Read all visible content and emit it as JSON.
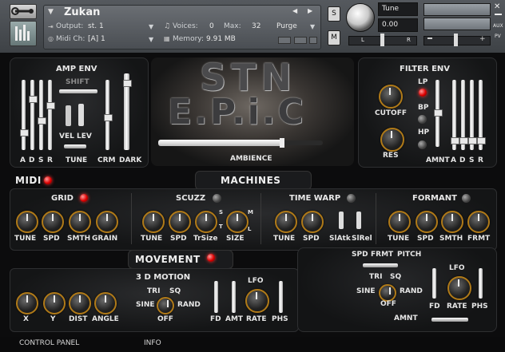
{
  "header": {
    "instrument_name": "Zukan",
    "output_label": "Output:",
    "output_value": "st. 1",
    "voices_label": "Voices:",
    "voices_value": "0",
    "max_label": "Max:",
    "max_value": "32",
    "purge_label": "Purge",
    "midi_label": "Midi Ch:",
    "midi_value": "[A] 1",
    "memory_label": "Memory:",
    "memory_value": "9.91 MB",
    "s_button": "S",
    "m_button": "M",
    "tune_label": "Tune",
    "tune_value": "0.00",
    "pan_left": "L",
    "pan_right": "R",
    "aux_label": "AUX",
    "pv_label": "PV",
    "nav_prev": "◀",
    "nav_next": "▶"
  },
  "logo": {
    "line1": "STN",
    "line2": "E.P.i.C",
    "ambience_label": "AMBIENCE"
  },
  "amp_env": {
    "title": "AMP ENV",
    "shift_label": "SHIFT",
    "vel_lev_label": "VEL LEV",
    "slider_labels": [
      "A",
      "D",
      "S",
      "R"
    ],
    "tune_label": "TUNE",
    "crm_label": "CRM",
    "dark_label": "DARK"
  },
  "filter_env": {
    "title": "FILTER ENV",
    "cutoff_label": "CUTOFF",
    "res_label": "RES",
    "lp_label": "LP",
    "bp_label": "BP",
    "hp_label": "HP",
    "amnt_label": "AMNT",
    "slider_labels": [
      "A",
      "D",
      "S",
      "R"
    ]
  },
  "midi_label": "MIDI",
  "machines_label": "MACHINES",
  "grid": {
    "title": "GRID",
    "knob_labels": [
      "TUNE",
      "SPD",
      "SMTH",
      "GRAIN"
    ]
  },
  "scuzz": {
    "title": "SCUZZ",
    "knob_labels": [
      "TUNE",
      "SPD",
      "TrSize",
      "SIZE"
    ],
    "size_marks": [
      "S",
      "T",
      "M",
      "L"
    ]
  },
  "time_warp": {
    "title": "TIME WARP",
    "knob_labels": [
      "TUNE",
      "SPD",
      "SlAtk",
      "SlRel"
    ]
  },
  "formant": {
    "title": "FORMANT",
    "knob_labels": [
      "TUNE",
      "SPD",
      "SMTH",
      "FRMT"
    ]
  },
  "movement": {
    "title": "MOVEMENT",
    "motion_title": "3 D MOTION",
    "xy_labels": [
      "X",
      "Y",
      "DIST",
      "ANGLE"
    ],
    "shape_tri": "TRI",
    "shape_sq": "SQ",
    "shape_sine": "SINE",
    "shape_rand": "RAND",
    "shape_off": "OFF",
    "lfo_label": "LFO",
    "fd_label": "FD",
    "amt_label": "AMT",
    "rate_label": "RATE",
    "phs_label": "PHS"
  },
  "right_lfo": {
    "spd_frmt_pitch": [
      "SPD",
      "FRMT",
      "PITCH"
    ],
    "shape_tri": "TRI",
    "shape_sq": "SQ",
    "shape_sine": "SINE",
    "shape_rand": "RAND",
    "shape_off": "OFF",
    "amnt_label": "AMNT",
    "lfo_label": "LFO",
    "fd_label": "FD",
    "rate_label": "RATE",
    "phs_label": "PHS"
  },
  "footer": {
    "control_panel": "CONTROL PANEL",
    "info": "INFO"
  }
}
